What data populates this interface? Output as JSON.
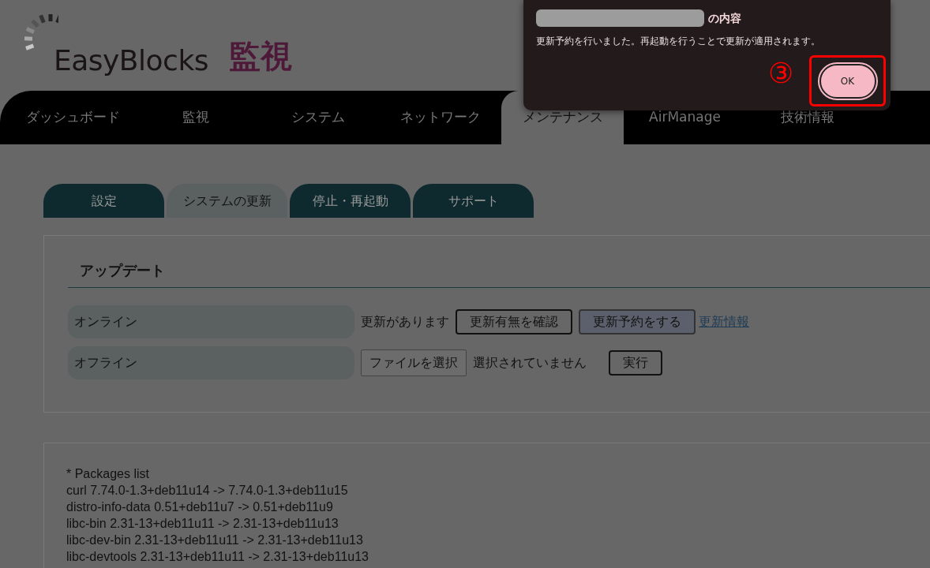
{
  "header": {
    "logo": "EasyBlocks",
    "page_title": "監視"
  },
  "main_nav": [
    {
      "label": "ダッシュボード",
      "selected": false
    },
    {
      "label": "監視",
      "selected": false
    },
    {
      "label": "システム",
      "selected": false
    },
    {
      "label": "ネットワーク",
      "selected": false
    },
    {
      "label": "メンテナンス",
      "selected": true
    },
    {
      "label": "AirManage",
      "selected": false
    },
    {
      "label": "技術情報",
      "selected": false
    }
  ],
  "sub_tabs": [
    {
      "label": "設定",
      "selected": false
    },
    {
      "label": "システムの更新",
      "selected": true
    },
    {
      "label": "停止・再起動",
      "selected": false
    },
    {
      "label": "サポート",
      "selected": false
    }
  ],
  "update_panel": {
    "heading": "アップデート",
    "rows": [
      {
        "kind": "online",
        "label": "オンライン",
        "status": "更新があります",
        "buttons": [
          {
            "label": "更新有無を確認",
            "focused": false
          },
          {
            "label": "更新予約をする",
            "focused": true
          }
        ],
        "link": "更新情報"
      },
      {
        "kind": "offline",
        "label": "オフライン",
        "file_button": "ファイルを選択",
        "file_status": "選択されていません",
        "buttons": [
          {
            "label": "実行",
            "focused": false
          }
        ]
      }
    ]
  },
  "packages": {
    "lines": [
      "* Packages list",
      "curl 7.74.0-1.3+deb11u14 -> 7.74.0-1.3+deb11u15",
      "distro-info-data 0.51+deb11u7 -> 0.51+deb11u9",
      "libc-bin 2.31-13+deb11u11 -> 2.31-13+deb11u13",
      "libc-dev-bin 2.31-13+deb11u11 -> 2.31-13+deb11u13",
      "libc-devtools 2.31-13+deb11u11 -> 2.31-13+deb11u13"
    ]
  },
  "dialog": {
    "title": "の内容",
    "message": "更新予約を行いました。再起動を行うことで更新が適用されます。",
    "ok_button": "OK",
    "annotation": "③"
  }
}
